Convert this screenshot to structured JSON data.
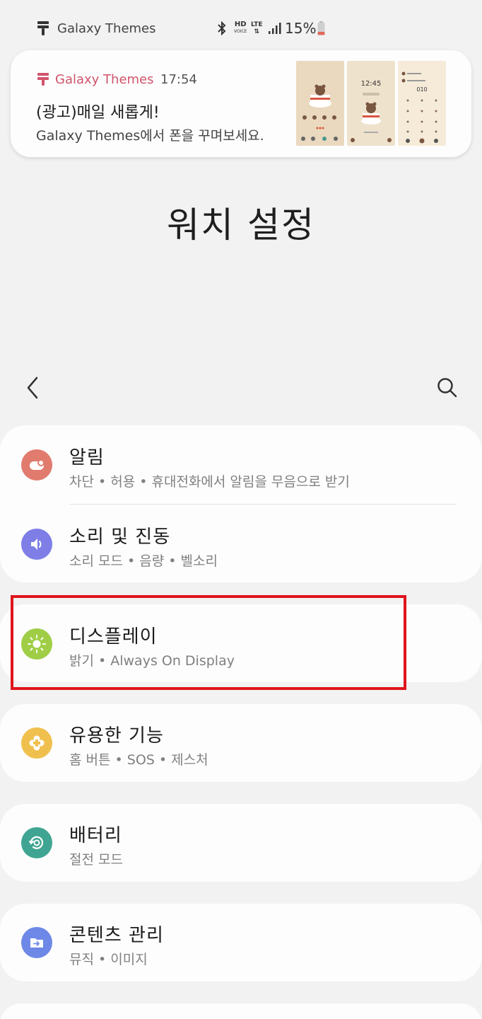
{
  "status_bar": {
    "app_name": "Galaxy Themes",
    "hd_label": "HD",
    "hd_sub": "VOICE",
    "lte_label": "LTE",
    "battery_percent": "15%"
  },
  "notification": {
    "app_name": "Galaxy Themes",
    "time": "17:54",
    "title": "(광고)매일 새롭게!",
    "body": "Galaxy Themes에서 폰을 꾸며보세요.",
    "thumb_time": "12:45",
    "thumb_dial": "010",
    "accent": "#d1546b"
  },
  "page": {
    "title": "워치 설정"
  },
  "menu": [
    {
      "title": "알림",
      "subtitle": "차단 • 허용 • 휴대전화에서 알림을 무음으로 받기",
      "icon": "notification-icon",
      "color": "#e07b6e"
    },
    {
      "title": "소리 및 진동",
      "subtitle": "소리 모드 • 음량 • 벨소리",
      "icon": "speaker-icon",
      "color": "#7e7ee6"
    },
    {
      "title": "디스플레이",
      "subtitle": "밝기 • Always On Display",
      "icon": "brightness-icon",
      "color": "#9fce46"
    },
    {
      "title": "유용한 기능",
      "subtitle": "홈 버튼 • SOS • 제스처",
      "icon": "plus-puzzle-icon",
      "color": "#f0c04e"
    },
    {
      "title": "배터리",
      "subtitle": "절전 모드",
      "icon": "battery-refresh-icon",
      "color": "#3fa592"
    },
    {
      "title": "콘텐츠 관리",
      "subtitle": "뮤직 • 이미지",
      "icon": "folder-icon",
      "color": "#6d88e6"
    }
  ],
  "highlight_color": "#e0141c"
}
